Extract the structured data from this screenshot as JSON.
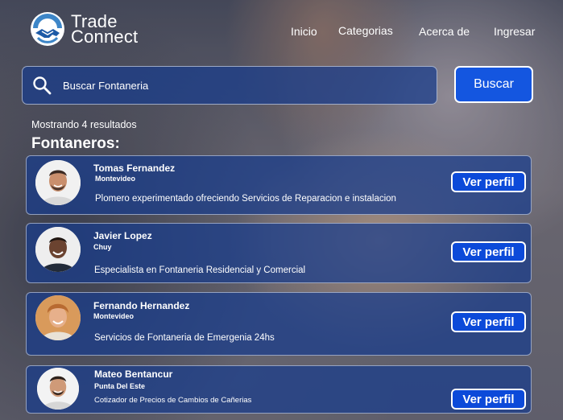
{
  "brand": {
    "line1": "Trade",
    "line2": "Connect"
  },
  "nav": {
    "inicio": "Inicio",
    "categorias": "Categorias",
    "acerca": "Acerca de",
    "ingresar": "Ingresar"
  },
  "search": {
    "value": "Buscar Fontaneria",
    "button": "Buscar"
  },
  "results": {
    "count_text": "Mostrando 4 resultados",
    "heading": "Fontaneros:"
  },
  "colors": {
    "accent": "#1456e0",
    "card_bg": "rgba(24,60,140,0.72)"
  },
  "professionals": [
    {
      "name": "Tomas Fernandez",
      "city": "Montevideo",
      "description": "Plomero experimentado ofreciendo Servicios de Reparacion e instalacion",
      "button": "Ver perfil"
    },
    {
      "name": "Javier Lopez",
      "city": "Chuy",
      "description": "Especialista en Fontaneria Residencial y Comercial",
      "button": "Ver perfil"
    },
    {
      "name": "Fernando Hernandez",
      "city": "Montevideo",
      "description": "Servicios de Fontaneria de Emergenia 24hs",
      "button": "Ver perfil"
    },
    {
      "name": "Mateo Bentancur",
      "city": "Punta Del Este",
      "description": "Cotizador de Precios de Cambios de Cañerias",
      "button": "Ver perfil"
    }
  ]
}
